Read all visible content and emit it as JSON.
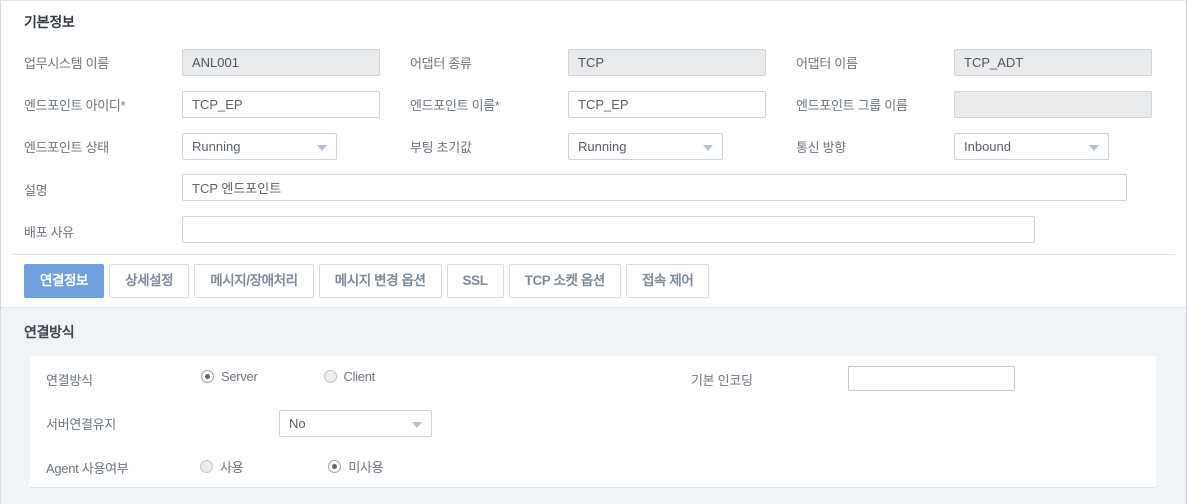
{
  "basic_info": {
    "title": "기본정보",
    "rows": [
      {
        "c1": {
          "label": "업무시스템 이름",
          "value": "ANL001",
          "type": "input-readonly"
        },
        "c2": {
          "label": "어댑터 종류",
          "value": "TCP",
          "type": "input-readonly"
        },
        "c3": {
          "label": "어댑터 이름",
          "value": "TCP_ADT",
          "type": "input-readonly"
        }
      },
      {
        "c1": {
          "label": "엔드포인트 아이디*",
          "value": "TCP_EP",
          "type": "input"
        },
        "c2": {
          "label": "엔드포인트 이름*",
          "value": "TCP_EP",
          "type": "input"
        },
        "c3": {
          "label": "엔드포인트 그룹 이름",
          "value": "",
          "type": "input-readonly"
        }
      },
      {
        "c1": {
          "label": "엔드포인트 상태",
          "value": "Running",
          "type": "select"
        },
        "c2": {
          "label": "부팅 초기값",
          "value": "Running",
          "type": "select"
        },
        "c3": {
          "label": "통신 방향",
          "value": "Inbound",
          "type": "select"
        }
      }
    ],
    "description": {
      "label": "설명",
      "value": "TCP 엔드포인트",
      "placeholder": ""
    },
    "deploy_reason": {
      "label": "배포 사유",
      "value": "",
      "placeholder": ""
    }
  },
  "tabs": [
    {
      "label": "연결정보",
      "active": true
    },
    {
      "label": "상세설정",
      "active": false
    },
    {
      "label": "메시지/장애처리",
      "active": false
    },
    {
      "label": "메시지 변경 옵션",
      "active": false
    },
    {
      "label": "SSL",
      "active": false
    },
    {
      "label": "TCP 소켓 옵션",
      "active": false
    },
    {
      "label": "접속 제어",
      "active": false
    }
  ],
  "connection_panel": {
    "title": "연결방식",
    "conn_method": {
      "label": "연결방식",
      "options": [
        {
          "label": "Server",
          "selected": true
        },
        {
          "label": "Client",
          "selected": false
        }
      ]
    },
    "encoding": {
      "label": "기본 인코딩",
      "value": "",
      "placeholder": ""
    },
    "keep_alive": {
      "label": "서버연결유지",
      "value": "No"
    },
    "agent_use": {
      "label": "Agent 사용여부",
      "options": [
        {
          "label": "사용",
          "selected": false
        },
        {
          "label": "미사용",
          "selected": true
        }
      ]
    }
  },
  "colors": {
    "accent": "#6fa0e0",
    "panel_bg": "#f0f4f7",
    "readonly_bg": "#e9ebed",
    "border": "#ccd3da",
    "label_text": "#6d767f"
  }
}
